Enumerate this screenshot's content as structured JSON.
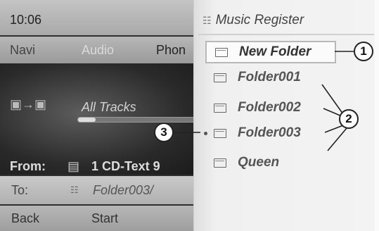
{
  "status": {
    "time": "10:06"
  },
  "menu": {
    "items": [
      "Navi",
      "Audio",
      "Phon"
    ]
  },
  "media": {
    "source_icon": "media-source-icon",
    "track_label": "All Tracks",
    "progress": 0.15,
    "from_label": "From:",
    "cd_icon": "cd-icon",
    "cd_name": "1 CD-Text 9"
  },
  "destination": {
    "to_label": "To:",
    "folder_icon": "music-register-icon",
    "path": "Folder003/"
  },
  "actions": {
    "back": "Back",
    "start": "Start"
  },
  "register": {
    "title_icon": "music-register-icon",
    "title": "Music Register",
    "new_folder": "New Folder",
    "folders": [
      "Folder001",
      "Folder002",
      "Folder003",
      "Queen"
    ]
  },
  "callouts": {
    "c1": "1",
    "c2": "2",
    "c3": "3"
  },
  "colors": {
    "panel_bg": "#f3f3f3",
    "dark_bg": "#2f2f2f",
    "bar_bg": "#b9b9b9"
  }
}
